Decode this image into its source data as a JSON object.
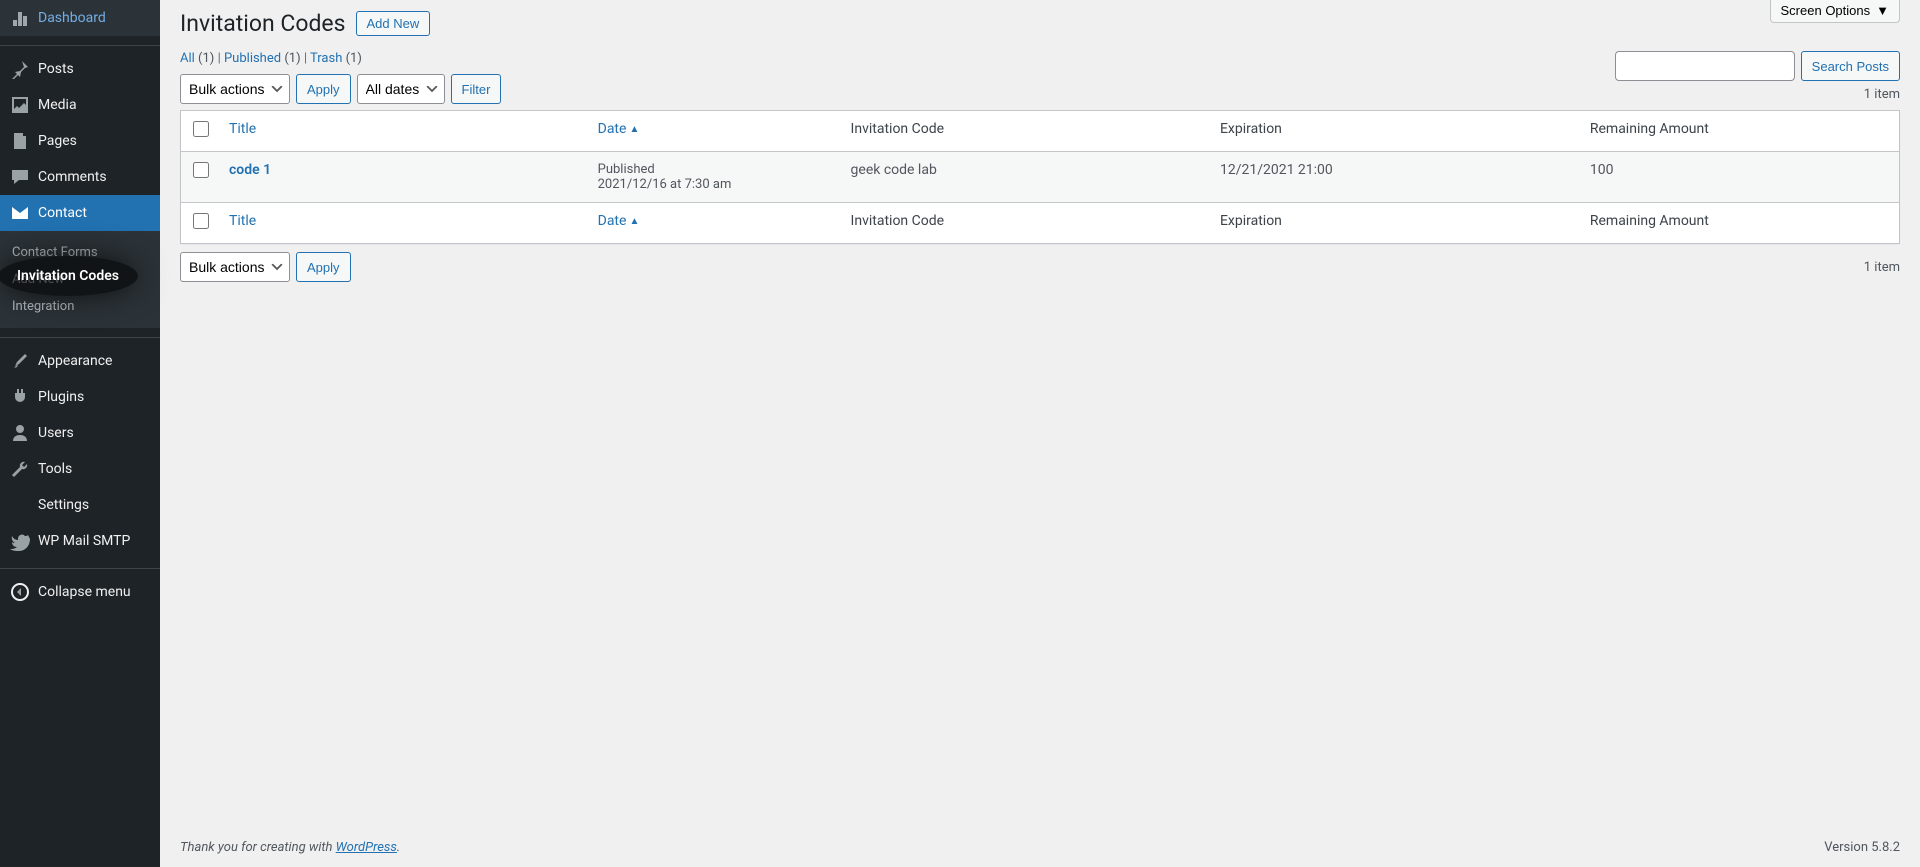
{
  "sidebar": {
    "items": [
      {
        "label": "Dashboard"
      },
      {
        "label": "Posts"
      },
      {
        "label": "Media"
      },
      {
        "label": "Pages"
      },
      {
        "label": "Comments"
      },
      {
        "label": "Contact"
      },
      {
        "label": "Appearance"
      },
      {
        "label": "Plugins"
      },
      {
        "label": "Users"
      },
      {
        "label": "Tools"
      },
      {
        "label": "Settings"
      },
      {
        "label": "WP Mail SMTP"
      },
      {
        "label": "Collapse menu"
      }
    ],
    "submenu": [
      {
        "label": "Contact Forms"
      },
      {
        "label": "Add New"
      },
      {
        "label": "Integration"
      }
    ],
    "highlight": "Invitation Codes"
  },
  "header": {
    "screen_options": "Screen Options",
    "title": "Invitation Codes",
    "add_new": "Add New"
  },
  "filters": {
    "all_label": "All",
    "all_count": "(1)",
    "published_label": "Published",
    "published_count": "(1)",
    "trash_label": "Trash",
    "trash_count": "(1)",
    "sep": " | "
  },
  "toolbar": {
    "bulk_label": "Bulk actions",
    "apply": "Apply",
    "dates_label": "All dates",
    "filter": "Filter",
    "search_btn": "Search Posts",
    "item_count": "1 item"
  },
  "table": {
    "cols": {
      "title": "Title",
      "date": "Date",
      "code": "Invitation Code",
      "exp": "Expiration",
      "rem": "Remaining Amount"
    },
    "rows": [
      {
        "title": "code 1",
        "date_status": "Published",
        "date_line": "2021/12/16 at 7:30 am",
        "code": "geek code lab",
        "exp": "12/21/2021 21:00",
        "rem": "100"
      }
    ]
  },
  "footer": {
    "thank": "Thank you for creating with ",
    "wp": "WordPress",
    "period": ".",
    "version": "Version 5.8.2"
  }
}
